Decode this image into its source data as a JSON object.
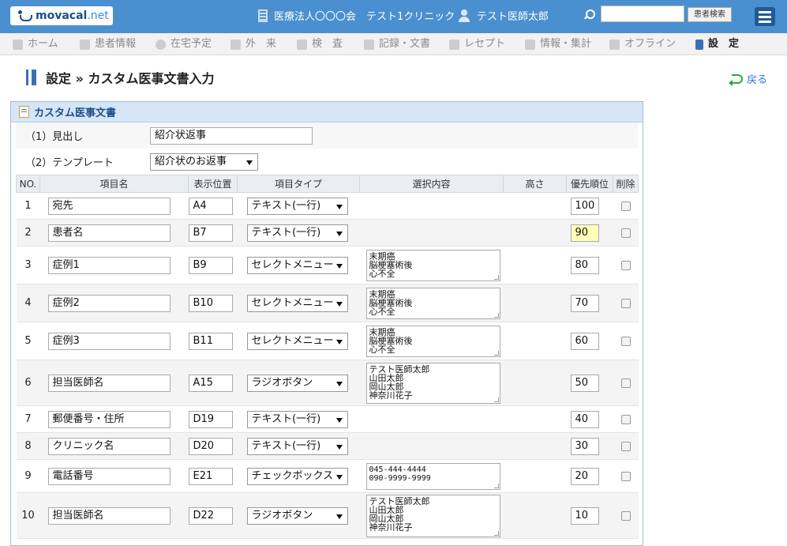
{
  "header": {
    "logo_text_main": "movacal",
    "logo_text_suffix": ".net",
    "org_label": "医療法人〇〇〇会　テスト1クリニック",
    "user_label": "テスト医師太郎",
    "search_placeholder": "",
    "search_button": "患者検索"
  },
  "nav": [
    {
      "label": "ホーム",
      "icon": "home-icon"
    },
    {
      "label": "患者情報",
      "icon": "patients-icon"
    },
    {
      "label": "在宅予定",
      "icon": "clock-icon"
    },
    {
      "label": "外　来",
      "icon": "outpatient-icon"
    },
    {
      "label": "検　査",
      "icon": "chart-icon"
    },
    {
      "label": "記録・文書",
      "icon": "document-icon"
    },
    {
      "label": "レセプト",
      "icon": "receipt-icon"
    },
    {
      "label": "情報・集計",
      "icon": "monitor-icon"
    },
    {
      "label": "オフライン",
      "icon": "offline-icon"
    },
    {
      "label": "設　定",
      "icon": "tools-icon"
    }
  ],
  "page": {
    "title": "設定 » カスタム医事文書入力",
    "back_label": "戻る"
  },
  "panel": {
    "title": "カスタム医事文書",
    "heading_label": "（1）見出し",
    "heading_value": "紹介状返事",
    "template_label": "（2）テンプレート",
    "template_value": "紹介状のお返事"
  },
  "table": {
    "headers": [
      "NO.",
      "項目名",
      "表示位置",
      "項目タイプ",
      "選択内容",
      "高さ",
      "優先順位",
      "削除"
    ],
    "rows": [
      {
        "no": "1",
        "name": "宛先",
        "pos": "A4",
        "type": "テキスト(一行)",
        "choices": "",
        "priority": "100"
      },
      {
        "no": "2",
        "name": "患者名",
        "pos": "B7",
        "type": "テキスト(一行)",
        "choices": "",
        "priority": "90"
      },
      {
        "no": "3",
        "name": "症例1",
        "pos": "B9",
        "type": "セレクトメニュー",
        "choices": "末期癌\n脳梗塞術後\n心不全",
        "priority": "80"
      },
      {
        "no": "4",
        "name": "症例2",
        "pos": "B10",
        "type": "セレクトメニュー",
        "choices": "末期癌\n脳梗塞術後\n心不全",
        "priority": "70"
      },
      {
        "no": "5",
        "name": "症例3",
        "pos": "B11",
        "type": "セレクトメニュー",
        "choices": "末期癌\n脳梗塞術後\n心不全",
        "priority": "60"
      },
      {
        "no": "6",
        "name": "担当医師名",
        "pos": "A15",
        "type": "ラジオボタン",
        "choices": "テスト医師太郎\n山田太郎\n岡山太郎\n神奈川花子",
        "priority": "50"
      },
      {
        "no": "7",
        "name": "郵便番号・住所",
        "pos": "D19",
        "type": "テキスト(一行)",
        "choices": "",
        "priority": "40"
      },
      {
        "no": "8",
        "name": "クリニック名",
        "pos": "D20",
        "type": "テキスト(一行)",
        "choices": "",
        "priority": "30"
      },
      {
        "no": "9",
        "name": "電話番号",
        "pos": "E21",
        "type": "チェックボックス",
        "choices": "045-444-4444\n090-9999-9999",
        "priority": "20"
      },
      {
        "no": "10",
        "name": "担当医師名",
        "pos": "D22",
        "type": "ラジオボタン",
        "choices": "テスト医師太郎\n山田太郎\n岡山太郎\n神奈川花子",
        "priority": "10"
      }
    ]
  },
  "colors": {
    "header_bg": "#4a90d0",
    "accent": "#3a6fb5",
    "highlight_input": "#ffffb8"
  }
}
